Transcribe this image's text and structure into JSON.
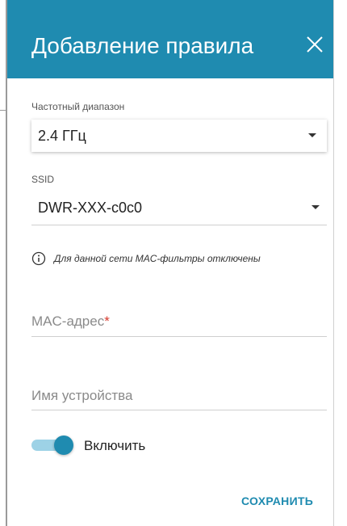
{
  "dialog": {
    "title": "Добавление правила",
    "close_icon": "close-icon"
  },
  "frequency": {
    "label": "Частотный диапазон",
    "value": "2.4 ГГц"
  },
  "ssid": {
    "label": "SSID",
    "value": "DWR-XXX-c0c0"
  },
  "info": {
    "icon": "info-icon",
    "text": "Для данной сети MAC-фильтры отключены"
  },
  "mac": {
    "placeholder": "MAC-адрес",
    "required_mark": "*",
    "value": ""
  },
  "device_name": {
    "placeholder": "Имя устройства",
    "value": ""
  },
  "enable": {
    "label": "Включить",
    "on": true
  },
  "actions": {
    "save_label": "СОХРАНИТЬ"
  },
  "colors": {
    "accent": "#1f8bb0",
    "toggle_track": "#9dd2e6",
    "required": "#d63b2f"
  }
}
